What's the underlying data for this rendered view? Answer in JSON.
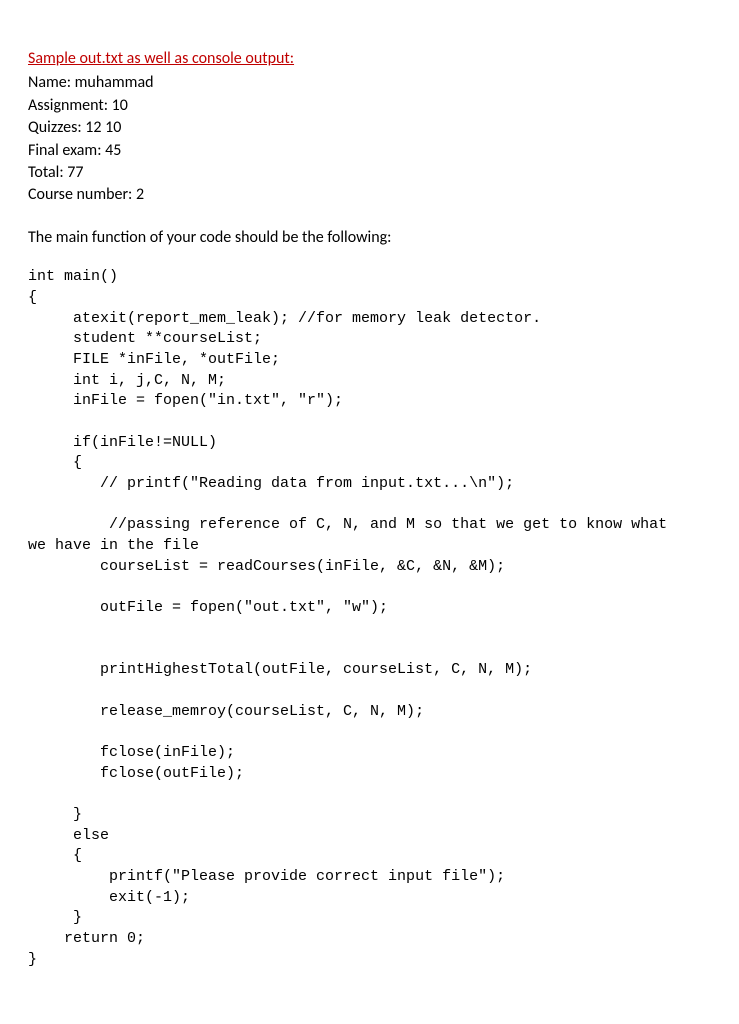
{
  "heading": "Sample out.txt as well as console output:",
  "info": {
    "name_label": "Name:",
    "name_value": "muhammad",
    "assignment_label": "Assignment:",
    "assignment_value": "10",
    "quizzes_label": "Quizzes:",
    "quizzes_value": "12 10",
    "final_label": "Final exam:",
    "final_value": "45",
    "total_label": "Total:",
    "total_value": "77",
    "course_label": "Course number:",
    "course_value": "2"
  },
  "instruction": "The main function of your code should be the following:",
  "code": "int main()\n{\n     atexit(report_mem_leak); //for memory leak detector.\n     student **courseList;\n     FILE *inFile, *outFile;\n     int i, j,C, N, M;\n     inFile = fopen(\"in.txt\", \"r\");\n\n     if(inFile!=NULL)\n     {\n        // printf(\"Reading data from input.txt...\\n\");\n\n         //passing reference of C, N, and M so that we get to know what\nwe have in the file\n        courseList = readCourses(inFile, &C, &N, &M);\n\n        outFile = fopen(\"out.txt\", \"w\");\n\n\n        printHighestTotal(outFile, courseList, C, N, M);\n\n        release_memroy(courseList, C, N, M);\n\n        fclose(inFile);\n        fclose(outFile);\n\n     }\n     else\n     {\n         printf(\"Please provide correct input file\");\n         exit(-1);\n     }\n    return 0;\n}"
}
